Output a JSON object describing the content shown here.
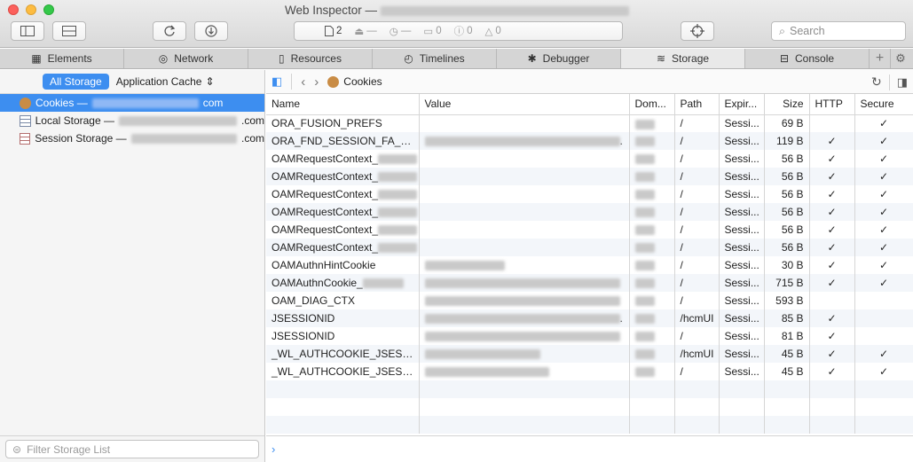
{
  "window": {
    "title": "Web Inspector —"
  },
  "toolbar": {
    "activity": {
      "resource_count": "2",
      "load": "—",
      "time": "—",
      "logs": "0",
      "errors": "0",
      "warnings": "0"
    },
    "search_placeholder": "Search"
  },
  "tabs": [
    {
      "label": "Elements"
    },
    {
      "label": "Network"
    },
    {
      "label": "Resources"
    },
    {
      "label": "Timelines"
    },
    {
      "label": "Debugger"
    },
    {
      "label": "Storage"
    },
    {
      "label": "Console"
    }
  ],
  "sidebar": {
    "scope_active": "All Storage",
    "scope_other": "Application Cache",
    "items": [
      {
        "label": "Cookies —",
        "suffix": "com"
      },
      {
        "label": "Local Storage —",
        "suffix": ".com"
      },
      {
        "label": "Session Storage —",
        "suffix": ".com"
      }
    ],
    "filter_placeholder": "Filter Storage List"
  },
  "content": {
    "breadcrumb": "Cookies",
    "columns": [
      "Name",
      "Value",
      "Dom...",
      "Path",
      "Expir...",
      "Size",
      "HTTP",
      "Secure"
    ],
    "rows": [
      {
        "name": "ORA_FUSION_PREFS",
        "value": "",
        "path": "/",
        "expires": "Sessi...",
        "size": "69 B",
        "http": "",
        "secure": "✓"
      },
      {
        "name": "ORA_FND_SESSION_FA_DEF...",
        "value": ".",
        "path": "/",
        "expires": "Sessi...",
        "size": "119 B",
        "http": "✓",
        "secure": "✓"
      },
      {
        "name": "OAMRequestContext_",
        "value": "",
        "path": "/",
        "expires": "Sessi...",
        "size": "56 B",
        "http": "✓",
        "secure": "✓"
      },
      {
        "name": "OAMRequestContext_",
        "value": "",
        "path": "/",
        "expires": "Sessi...",
        "size": "56 B",
        "http": "✓",
        "secure": "✓"
      },
      {
        "name": "OAMRequestContext_",
        "value": "",
        "path": "/",
        "expires": "Sessi...",
        "size": "56 B",
        "http": "✓",
        "secure": "✓"
      },
      {
        "name": "OAMRequestContext_",
        "value": "",
        "path": "/",
        "expires": "Sessi...",
        "size": "56 B",
        "http": "✓",
        "secure": "✓"
      },
      {
        "name": "OAMRequestContext_",
        "value": "",
        "path": "/",
        "expires": "Sessi...",
        "size": "56 B",
        "http": "✓",
        "secure": "✓"
      },
      {
        "name": "OAMRequestContext_",
        "value": "",
        "path": "/",
        "expires": "Sessi...",
        "size": "56 B",
        "http": "✓",
        "secure": "✓"
      },
      {
        "name": "OAMAuthnHintCookie",
        "value": "",
        "path": "/",
        "expires": "Sessi...",
        "size": "30 B",
        "http": "✓",
        "secure": "✓"
      },
      {
        "name": "OAMAuthnCookie_",
        "value": "",
        "path": "/",
        "expires": "Sessi...",
        "size": "715 B",
        "http": "✓",
        "secure": "✓"
      },
      {
        "name": "OAM_DIAG_CTX",
        "value": "",
        "path": "/",
        "expires": "Sessi...",
        "size": "593 B",
        "http": "",
        "secure": ""
      },
      {
        "name": "JSESSIONID",
        "value": ".",
        "path": "/hcmUI",
        "expires": "Sessi...",
        "size": "85 B",
        "http": "✓",
        "secure": ""
      },
      {
        "name": "JSESSIONID",
        "value": "",
        "path": "/",
        "expires": "Sessi...",
        "size": "81 B",
        "http": "✓",
        "secure": ""
      },
      {
        "name": "_WL_AUTHCOOKIE_JSESSIO...",
        "value": "",
        "path": "/hcmUI",
        "expires": "Sessi...",
        "size": "45 B",
        "http": "✓",
        "secure": "✓"
      },
      {
        "name": "_WL_AUTHCOOKIE_JSESSIO...",
        "value": "",
        "path": "/",
        "expires": "Sessi...",
        "size": "45 B",
        "http": "✓",
        "secure": "✓"
      }
    ],
    "console_prompt": "›"
  }
}
